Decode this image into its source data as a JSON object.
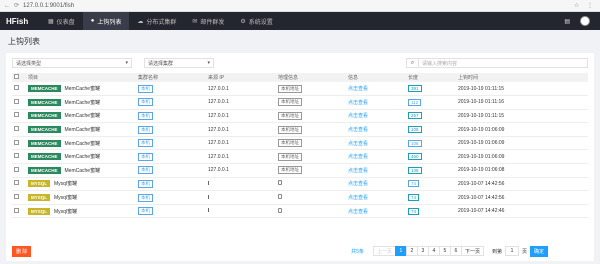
{
  "browser": {
    "url": "127.0.0.1:9001/fish"
  },
  "nav": {
    "logo": "HFish",
    "items": [
      {
        "label": "仪表盘"
      },
      {
        "label": "上钩列表"
      },
      {
        "label": "分布式集群"
      },
      {
        "label": "邮件群发"
      },
      {
        "label": "系统设置"
      }
    ]
  },
  "page_title": "上钩列表",
  "filters": {
    "type_placeholder": "请选择类型",
    "cluster_placeholder": "请选择集群",
    "search_placeholder": "请输入搜索内容"
  },
  "table": {
    "headers": [
      "项目",
      "集群名称",
      "来源 IP",
      "地理信息",
      "信息",
      "长度",
      "上钩时间"
    ],
    "rows": [
      {
        "tag": "MEMCACHE",
        "name": "MemCache蜜罐",
        "cluster": "本机",
        "ip": "127.0.0.1",
        "geo": "本机地址",
        "info": "点击查看",
        "len": "391",
        "time": "2019-10-19 01:11:15"
      },
      {
        "tag": "MEMCACHE",
        "name": "MemCache蜜罐",
        "cluster": "本机",
        "ip": "127.0.0.1",
        "geo": "本机地址",
        "info": "点击查看",
        "len": "112",
        "time": "2019-10-19 01:11:16"
      },
      {
        "tag": "MEMCACHE",
        "name": "MemCache蜜罐",
        "cluster": "本机",
        "ip": "127.0.0.1",
        "geo": "本机地址",
        "info": "点击查看",
        "len": "257",
        "time": "2019-10-19 01:11:15"
      },
      {
        "tag": "MEMCACHE",
        "name": "MemCache蜜罐",
        "cluster": "本机",
        "ip": "127.0.0.1",
        "geo": "本机地址",
        "info": "点击查看",
        "len": "108",
        "time": "2019-10-19 01:06:09"
      },
      {
        "tag": "MEMCACHE",
        "name": "MemCache蜜罐",
        "cluster": "本机",
        "ip": "127.0.0.1",
        "geo": "本机地址",
        "info": "点击查看",
        "len": "108",
        "time": "2019-10-19 01:06:09"
      },
      {
        "tag": "MEMCACHE",
        "name": "MemCache蜜罐",
        "cluster": "本机",
        "ip": "127.0.0.1",
        "geo": "本机地址",
        "info": "点击查看",
        "len": "460",
        "time": "2019-10-19 01:06:09"
      },
      {
        "tag": "MEMCACHE",
        "name": "MemCache蜜罐",
        "cluster": "本机",
        "ip": "127.0.0.1",
        "geo": "本机地址",
        "info": "点击查看",
        "len": "108",
        "time": "2019-10-19 01:06:08"
      },
      {
        "tag": "MYSQL",
        "name": "Mysql蜜罐",
        "cluster": "本机",
        "ip": "",
        "geo": "",
        "info": "点击查看",
        "len": "74",
        "time": "2019-10-07 14:42:56"
      },
      {
        "tag": "MYSQL",
        "name": "Mysql蜜罐",
        "cluster": "本机",
        "ip": "",
        "geo": "",
        "info": "点击查看",
        "len": "74",
        "time": "2019-10-07 14:42:56"
      },
      {
        "tag": "MYSQL",
        "name": "Mysql蜜罐",
        "cluster": "本机",
        "ip": "",
        "geo": "",
        "info": "点击查看",
        "len": "74",
        "time": "2019-10-07 14:42:46"
      }
    ]
  },
  "footer": {
    "delete": "删 除",
    "total": "共5条",
    "prev": "上一页",
    "pages": [
      "1",
      "2",
      "3",
      "4",
      "5",
      "6"
    ],
    "next": "下一页",
    "goto": "到第",
    "goto_value": "1",
    "page_unit": "页",
    "confirm": "确定"
  }
}
